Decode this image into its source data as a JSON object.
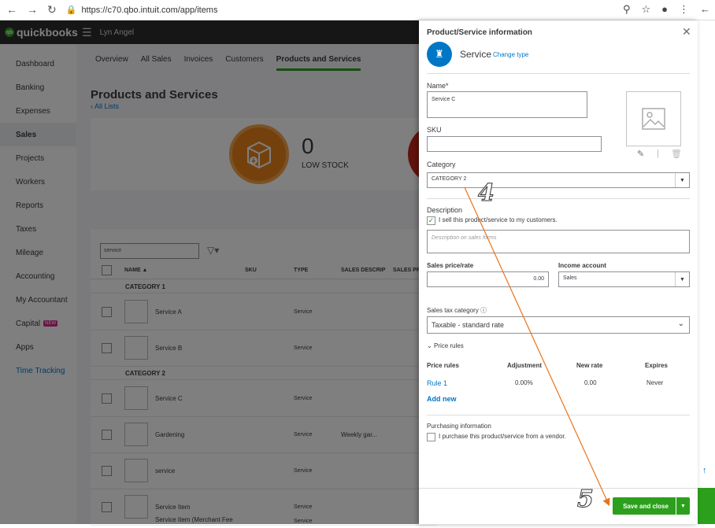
{
  "browser": {
    "url": "https://c70.qbo.intuit.com/app/items"
  },
  "topbar": {
    "logo_small": "intuit",
    "logo": "quickbooks",
    "company": "Lyn Angel"
  },
  "sidebar": {
    "items": [
      {
        "label": "Dashboard"
      },
      {
        "label": "Banking"
      },
      {
        "label": "Expenses"
      },
      {
        "label": "Sales"
      },
      {
        "label": "Projects"
      },
      {
        "label": "Workers"
      },
      {
        "label": "Reports"
      },
      {
        "label": "Taxes"
      },
      {
        "label": "Mileage"
      },
      {
        "label": "Accounting"
      },
      {
        "label": "My Accountant"
      },
      {
        "label": "Capital"
      },
      {
        "label": "Apps"
      },
      {
        "label": "Time Tracking"
      }
    ],
    "new_badge": "NEW"
  },
  "subnav": {
    "tabs": [
      "Overview",
      "All Sales",
      "Invoices",
      "Customers",
      "Products and Services"
    ]
  },
  "page": {
    "title": "Products and Services",
    "all_lists": "All Lists"
  },
  "stock": {
    "count": "0",
    "label": "LOW STOCK"
  },
  "table": {
    "search_value": "service",
    "headers": [
      "NAME ▲",
      "SKU",
      "TYPE",
      "SALES DESCRIP",
      "SALES PR"
    ],
    "category1": "CATEGORY 1",
    "category2": "CATEGORY 2",
    "rows": [
      {
        "name": "Service A",
        "type": "Service",
        "desc": ""
      },
      {
        "name": "Service B",
        "type": "Service",
        "desc": ""
      },
      {
        "name": "Service C",
        "type": "Service",
        "desc": ""
      },
      {
        "name": "Gardening",
        "type": "Service",
        "desc": "Weekly gar..."
      },
      {
        "name": "service",
        "type": "Service",
        "desc": ""
      },
      {
        "name": "Service Item",
        "type": "Service",
        "desc": ""
      },
      {
        "name": "Service Item (Merchant Fee",
        "type": "Service",
        "desc": ""
      }
    ]
  },
  "panel": {
    "title": "Product/Service information",
    "type": "Service",
    "change_type": "Change type",
    "name_label": "Name*",
    "name_value": "Service C",
    "sku_label": "SKU",
    "category_label": "Category",
    "category_value": "CATEGORY 2",
    "description_label": "Description",
    "sell_label": "I sell this product/service to my customers.",
    "desc_placeholder": "Description on sales forms",
    "price_label": "Sales price/rate",
    "price_value": "0.00",
    "income_label": "Income account",
    "income_value": "Sales",
    "tax_label": "Sales tax category",
    "tax_value": "Taxable - standard rate",
    "price_rules_toggle": "Price rules",
    "pr_headers": [
      "Price rules",
      "Adjustment",
      "New rate",
      "Expires"
    ],
    "pr_row": [
      "Rule 1",
      "0.00%",
      "0.00",
      "Never"
    ],
    "add_new": "Add new",
    "purchasing_label": "Purchasing information",
    "purchase_label": "I purchase this product/service from a vendor.",
    "save_label": "Save and close"
  },
  "annotations": {
    "step4": "4",
    "step5": "5"
  }
}
